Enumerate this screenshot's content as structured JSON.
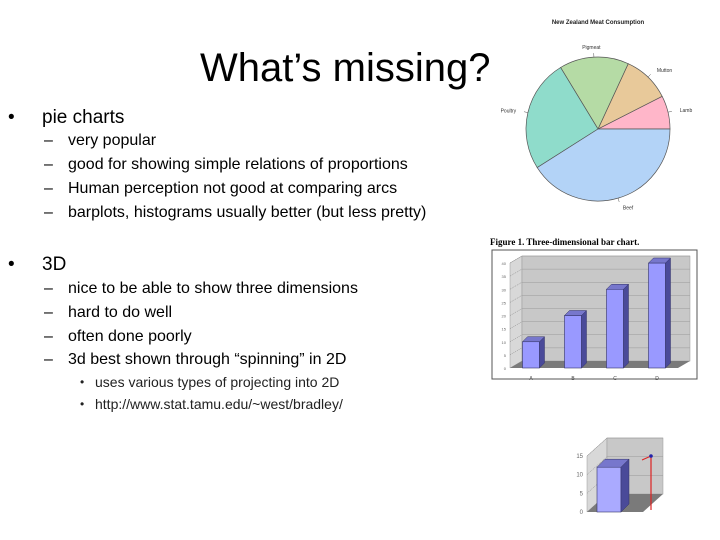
{
  "slide": {
    "title": "What’s missing?",
    "sections": [
      {
        "bullet": "•",
        "heading": "pie charts",
        "items": [
          "very popular",
          "good for showing simple relations of proportions",
          "Human perception not good at comparing arcs",
          "barplots, histograms usually better (but less pretty)"
        ]
      },
      {
        "bullet": "•",
        "heading": "3D",
        "items": [
          "nice to be able to show three dimensions",
          "hard to do well",
          "often done poorly",
          "3d best shown through “spinning” in 2D"
        ],
        "subitems": [
          "uses various types of projecting into 2D",
          "http://www.stat.tamu.edu/~west/bradley/"
        ]
      }
    ],
    "dash": "–",
    "subbullet": "•"
  },
  "chart_data": [
    {
      "type": "pie",
      "title": "New Zealand Meat Consumption",
      "labels": [
        "Lamb",
        "Mutton",
        "Pigmeat",
        "Poultry",
        "Beef"
      ],
      "values": [
        7.5,
        10.6,
        15.6,
        25.3,
        41.0
      ],
      "colors": [
        "#ffb6c9",
        "#e8c99a",
        "#b5dba5",
        "#8fdccb",
        "#b3d3f7"
      ],
      "start_angle_deg": 0,
      "direction": "counterclockwise"
    },
    {
      "type": "bar",
      "title": "Figure 1. Three-dimensional bar chart.",
      "categories": [
        "A",
        "B",
        "C",
        "D"
      ],
      "values": [
        10,
        20,
        30,
        40
      ],
      "ylim": [
        0,
        40
      ],
      "yticks": [
        0,
        5,
        10,
        15,
        20,
        25,
        30,
        35,
        40
      ],
      "grid": true,
      "style": "3d",
      "bar_color": "#9999ff"
    },
    {
      "type": "bar",
      "title": "",
      "categories": [
        ""
      ],
      "values": [
        12
      ],
      "ylim": [
        0,
        15
      ],
      "yticks": [
        0,
        5,
        10,
        15
      ],
      "grid": true,
      "style": "3d",
      "bar_color": "#aaaaff"
    }
  ]
}
